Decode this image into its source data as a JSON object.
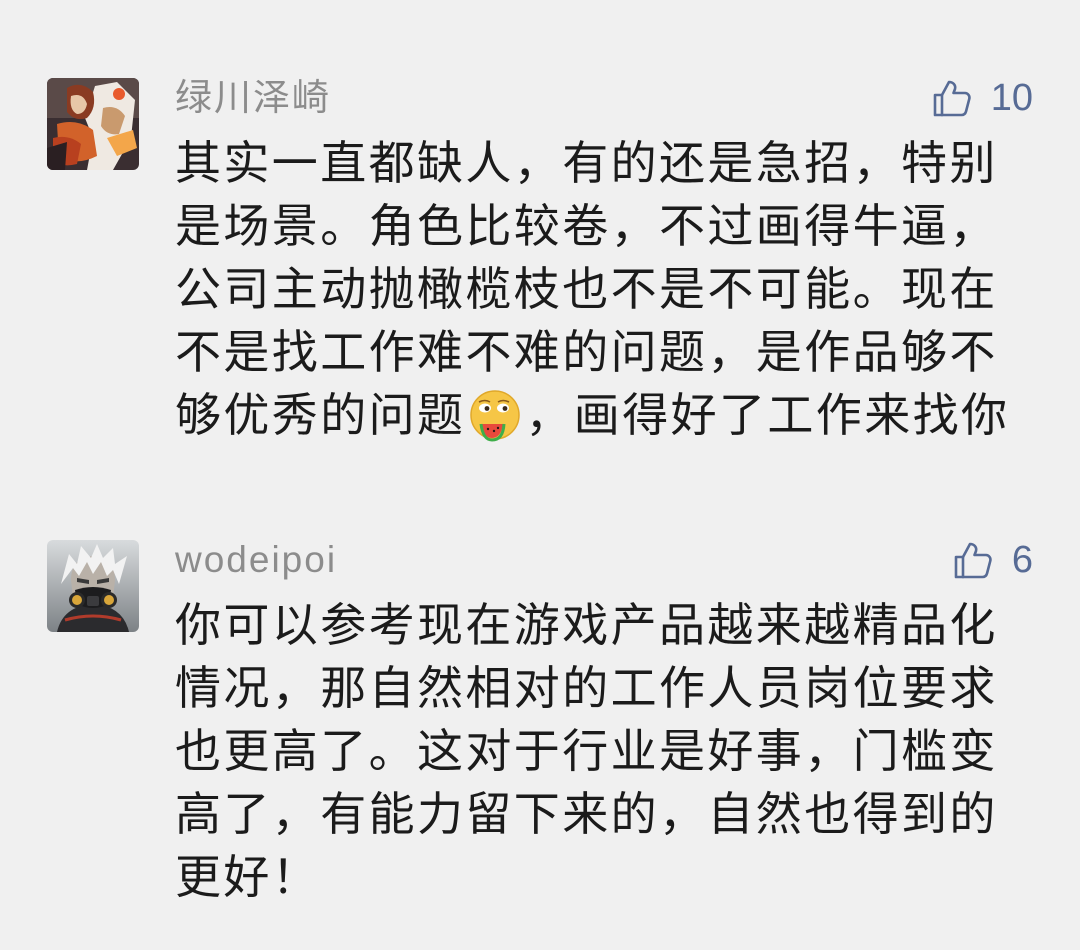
{
  "colors": {
    "background": "#f0f0f0",
    "username": "#8c8c8c",
    "text": "#1b1b1b",
    "like": "#576b95"
  },
  "comments": [
    {
      "username": "绿川泽崎",
      "avatar_icon": "anime-character-avatar",
      "like_icon": "thumbs-up-icon",
      "likes": "10",
      "lines": [
        "其实一直都缺人，有的还是急招，特别",
        "是场景。角色比较卷，不过画得牛逼，",
        "公司主动抛橄榄枝也不是不可能。现在",
        "不是找工作难不难的问题，是作品够不"
      ],
      "last_line": {
        "before": "够优秀的问题",
        "emoji": "melon-eating-face-emoji",
        "after": "，画得好了工作来找你"
      }
    },
    {
      "username": "wodeipoi",
      "avatar_icon": "masked-character-avatar",
      "like_icon": "thumbs-up-icon",
      "likes": "6",
      "lines": [
        "你可以参考现在游戏产品越来越精品化",
        "情况，那自然相对的工作人员岗位要求",
        "也更高了。这对于行业是好事，门槛变",
        "高了，有能力留下来的，自然也得到的",
        "更好！"
      ]
    }
  ]
}
